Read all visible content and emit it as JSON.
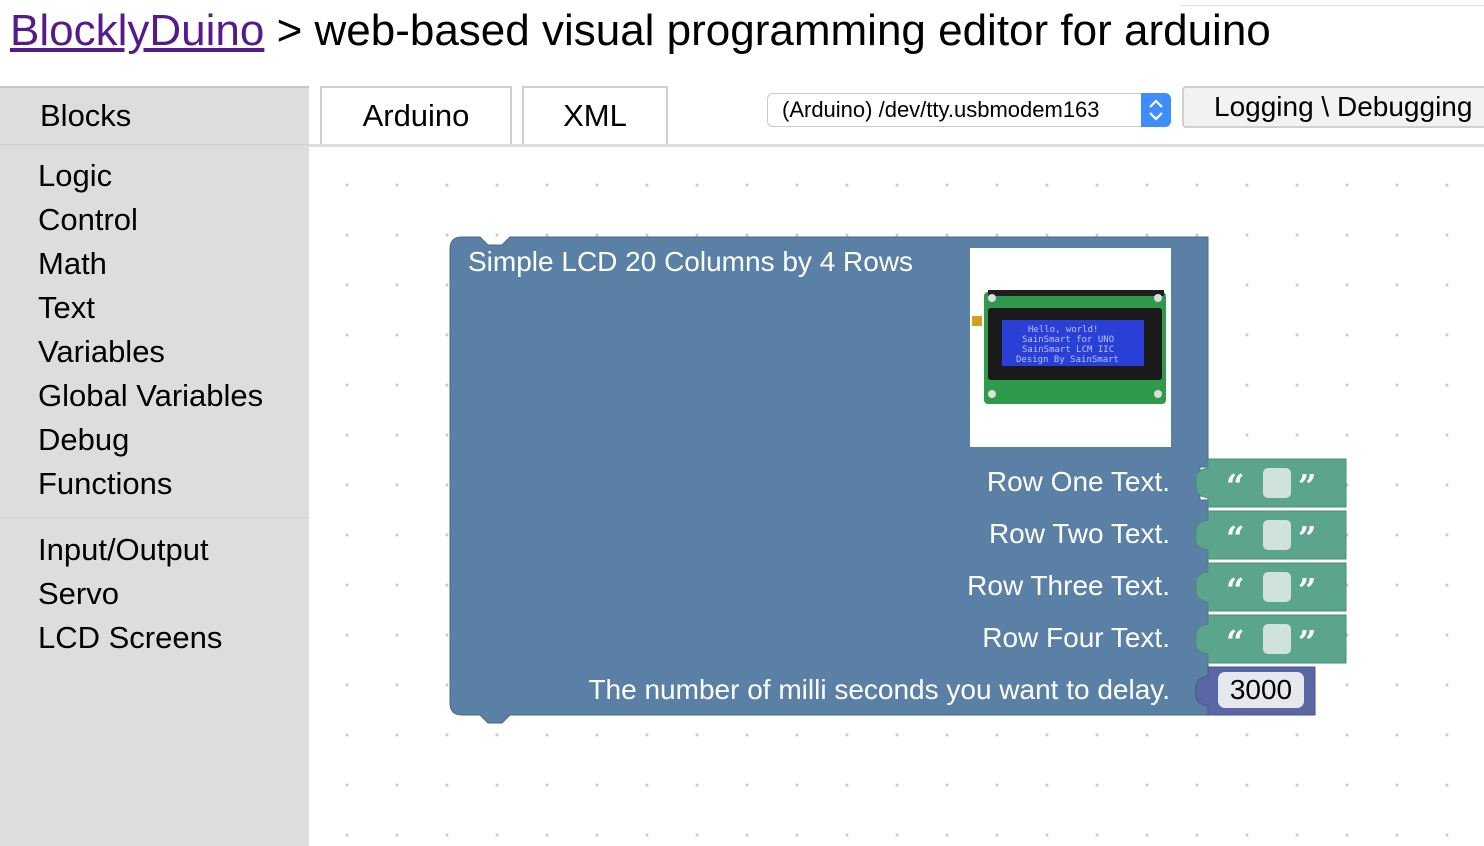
{
  "header": {
    "link_text": "BlocklyDuino",
    "subtitle": " > web-based visual programming editor for arduino"
  },
  "sidebar": {
    "title": "Blocks",
    "categories": [
      "Logic",
      "Control",
      "Math",
      "Text",
      "Variables",
      "Global Variables",
      "Debug",
      "Functions"
    ],
    "categories2": [
      "Input/Output",
      "Servo",
      "LCD Screens"
    ]
  },
  "tabs": {
    "arduino": "Arduino",
    "xml": "XML"
  },
  "port_select": {
    "value": "(Arduino) /dev/tty.usbmodem163"
  },
  "logging_button": {
    "label": "Logging \\ Debugging"
  },
  "lcd_block": {
    "title": "Simple LCD 20 Columns by 4 Rows",
    "rows": [
      "Row One Text.",
      "Row Two Text.",
      "Row Three Text.",
      "Row Four Text."
    ],
    "delay_label": "The number of milli seconds you want to delay.",
    "delay_value": "3000",
    "lcd_lines": [
      "Hello, world!",
      "SainSmart for UNO",
      "SainSmart LCM IIC",
      "Design By SainSmart"
    ]
  },
  "colors": {
    "block": "#5b80a5",
    "text_block": "#5ba58c",
    "link": "#551a8b",
    "sidebar_bg": "#dddddd",
    "select_arrow": "#3d8ef8"
  },
  "icons": [
    "open-quote-icon",
    "close-quote-icon",
    "select-arrows-icon"
  ]
}
